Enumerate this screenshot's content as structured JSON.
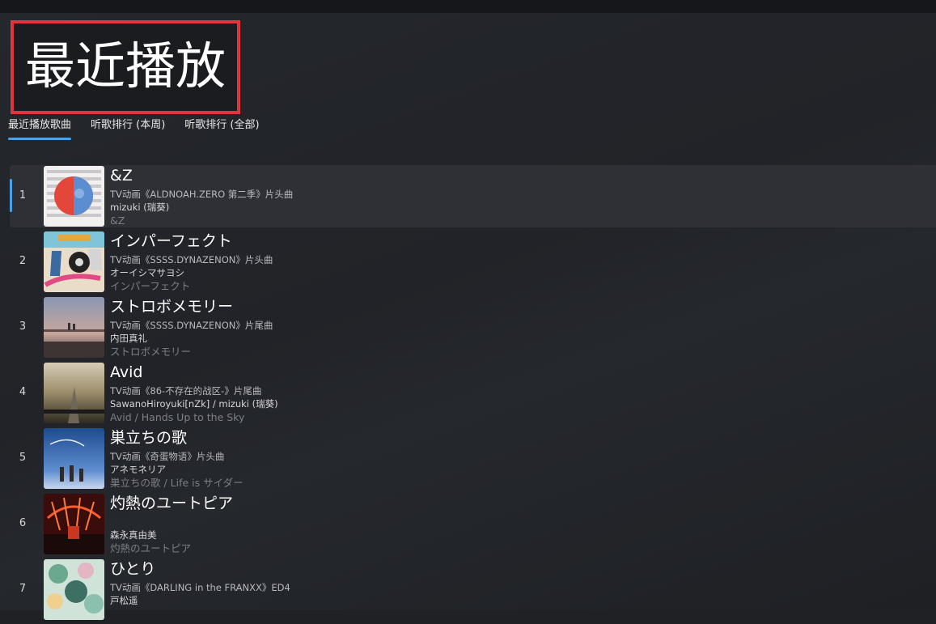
{
  "page": {
    "title": "最近播放",
    "highlight_color": "#e2343c",
    "accent_color": "#4aa3e8"
  },
  "tabs": [
    {
      "label": "最近播放歌曲",
      "active": true
    },
    {
      "label": "听歌排行 (本周)",
      "active": false
    },
    {
      "label": "听歌排行 (全部)",
      "active": false
    }
  ],
  "songs": [
    {
      "index": "1",
      "title": "&Z",
      "desc": "TV动画《ALDNOAH.ZERO 第二季》片头曲",
      "artist": "mizuki (瑞葵)",
      "album": "&Z",
      "selected": true
    },
    {
      "index": "2",
      "title": "インパーフェクト",
      "desc": "TV动画《SSSS.DYNAZENON》片头曲",
      "artist": "オーイシマサヨシ",
      "album": "インパーフェクト",
      "selected": false
    },
    {
      "index": "3",
      "title": "ストロボメモリー",
      "desc": "TV动画《SSSS.DYNAZENON》片尾曲",
      "artist": "内田真礼",
      "album": "ストロボメモリー",
      "selected": false
    },
    {
      "index": "4",
      "title": "Avid",
      "desc": "TV动画《86-不存在的战区-》片尾曲",
      "artist": "SawanoHiroyuki[nZk] / mizuki (瑞葵)",
      "album": "Avid / Hands Up to the Sky",
      "selected": false
    },
    {
      "index": "5",
      "title": "巣立ちの歌",
      "desc": "TV动画《奇蛋物语》片头曲",
      "artist": "アネモネリア",
      "album": "巣立ちの歌 / Life is サイダー",
      "selected": false
    },
    {
      "index": "6",
      "title": "灼熱のユートピア",
      "desc": "",
      "artist": "森永真由美",
      "album": "灼熱のユートピア",
      "selected": false
    },
    {
      "index": "7",
      "title": "ひとり",
      "desc": "TV动画《DARLING in the FRANXX》ED4",
      "artist": "戸松遥",
      "album": "",
      "selected": false
    }
  ]
}
